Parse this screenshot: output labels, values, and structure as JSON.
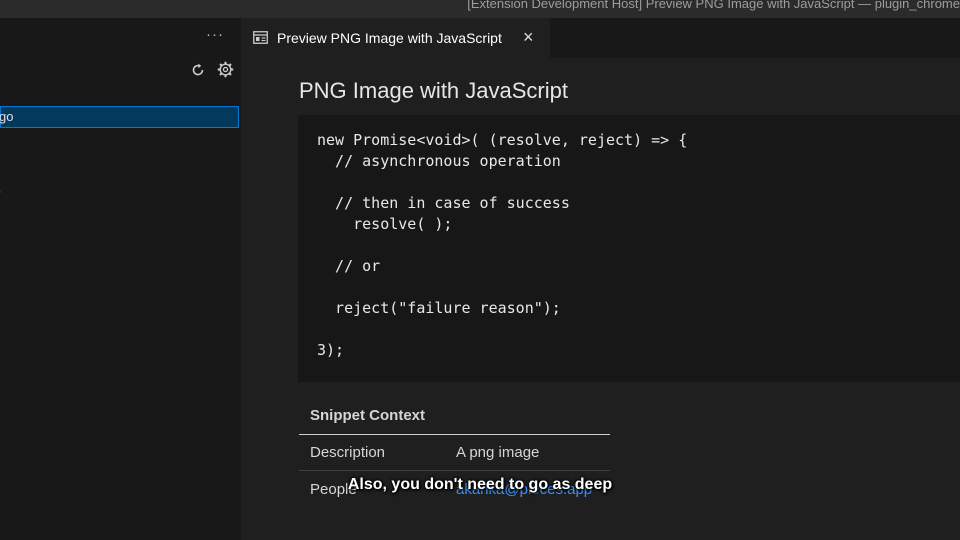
{
  "window": {
    "title": "[Extension Development Host] Preview PNG Image with JavaScript — plugin_chrome"
  },
  "sidebar": {
    "more_actions": "···",
    "refresh_icon": "refresh-icon",
    "settings_icon": "gear-icon",
    "selected_item": "go",
    "partial_glyph": "·"
  },
  "tab": {
    "label": "Preview PNG Image with JavaScript",
    "icon": "preview-icon",
    "close": "×"
  },
  "preview": {
    "heading": "PNG Image with JavaScript",
    "code": "new Promise<void>( (resolve, reject) => {\n  // asynchronous operation\n\n  // then in case of success\n    resolve( );\n\n  // or\n\n  reject(\"failure reason\");\n\n3);",
    "context": {
      "title": "Snippet Context",
      "rows": [
        {
          "key": "Description",
          "value": "A png image"
        },
        {
          "key": "People",
          "value": "akanka@pieces.app"
        }
      ]
    }
  },
  "caption": "Also, you don't need to go as deep",
  "colors": {
    "accent": "#0078d4",
    "selection_bg": "#04395e",
    "link": "#3794ff",
    "editor_bg": "#1f1f1f",
    "code_bg": "#171717"
  }
}
